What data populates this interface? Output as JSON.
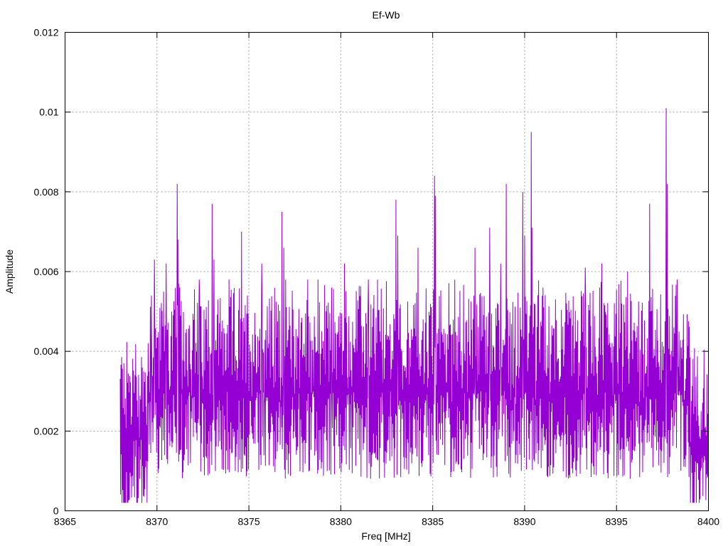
{
  "chart_data": {
    "type": "line",
    "title": "Ef-Wb",
    "xlabel": "Freq [MHz]",
    "ylabel": "Amplitude",
    "xlim": [
      8365,
      8400
    ],
    "ylim": [
      0,
      0.012
    ],
    "x_ticks": [
      "8365",
      "8370",
      "8375",
      "8380",
      "8385",
      "8390",
      "8395",
      "8400"
    ],
    "y_ticks": [
      "0",
      "0.002",
      "0.004",
      "0.006",
      "0.008",
      "0.01",
      "0.012"
    ],
    "grid": true,
    "legend": "none",
    "series": [
      {
        "color": "#9400d3",
        "x_start": 8368.0,
        "x_end": 8400.0,
        "peaks": [
          {
            "x": 8368.2,
            "y": 0.0037
          },
          {
            "x": 8369.7,
            "y": 0.0054
          },
          {
            "x": 8369.85,
            "y": 0.0063
          },
          {
            "x": 8370.5,
            "y": 0.0062
          },
          {
            "x": 8371.1,
            "y": 0.0082
          },
          {
            "x": 8371.15,
            "y": 0.0068
          },
          {
            "x": 8372.3,
            "y": 0.0058
          },
          {
            "x": 8373.0,
            "y": 0.0077
          },
          {
            "x": 8373.1,
            "y": 0.0063
          },
          {
            "x": 8374.6,
            "y": 0.007
          },
          {
            "x": 8375.7,
            "y": 0.0062
          },
          {
            "x": 8376.8,
            "y": 0.0075
          },
          {
            "x": 8376.9,
            "y": 0.0066
          },
          {
            "x": 8378.2,
            "y": 0.0058
          },
          {
            "x": 8379.5,
            "y": 0.0056
          },
          {
            "x": 8380.2,
            "y": 0.0062
          },
          {
            "x": 8381.5,
            "y": 0.0058
          },
          {
            "x": 8382.0,
            "y": 0.0058
          },
          {
            "x": 8383.0,
            "y": 0.0078
          },
          {
            "x": 8383.1,
            "y": 0.0069
          },
          {
            "x": 8384.2,
            "y": 0.0066
          },
          {
            "x": 8385.1,
            "y": 0.0084
          },
          {
            "x": 8385.15,
            "y": 0.0079
          },
          {
            "x": 8386.2,
            "y": 0.0058
          },
          {
            "x": 8387.3,
            "y": 0.0066
          },
          {
            "x": 8388.1,
            "y": 0.0071
          },
          {
            "x": 8388.7,
            "y": 0.0062
          },
          {
            "x": 8389.0,
            "y": 0.0082
          },
          {
            "x": 8389.9,
            "y": 0.008
          },
          {
            "x": 8390.0,
            "y": 0.0069
          },
          {
            "x": 8390.35,
            "y": 0.0095
          },
          {
            "x": 8390.4,
            "y": 0.0071
          },
          {
            "x": 8393.3,
            "y": 0.0061
          },
          {
            "x": 8394.2,
            "y": 0.0062
          },
          {
            "x": 8395.6,
            "y": 0.006
          },
          {
            "x": 8396.8,
            "y": 0.0077
          },
          {
            "x": 8397.7,
            "y": 0.0101
          },
          {
            "x": 8397.75,
            "y": 0.0082
          },
          {
            "x": 8398.3,
            "y": 0.0058
          },
          {
            "x": 8399.6,
            "y": 0.0025
          }
        ]
      }
    ]
  }
}
